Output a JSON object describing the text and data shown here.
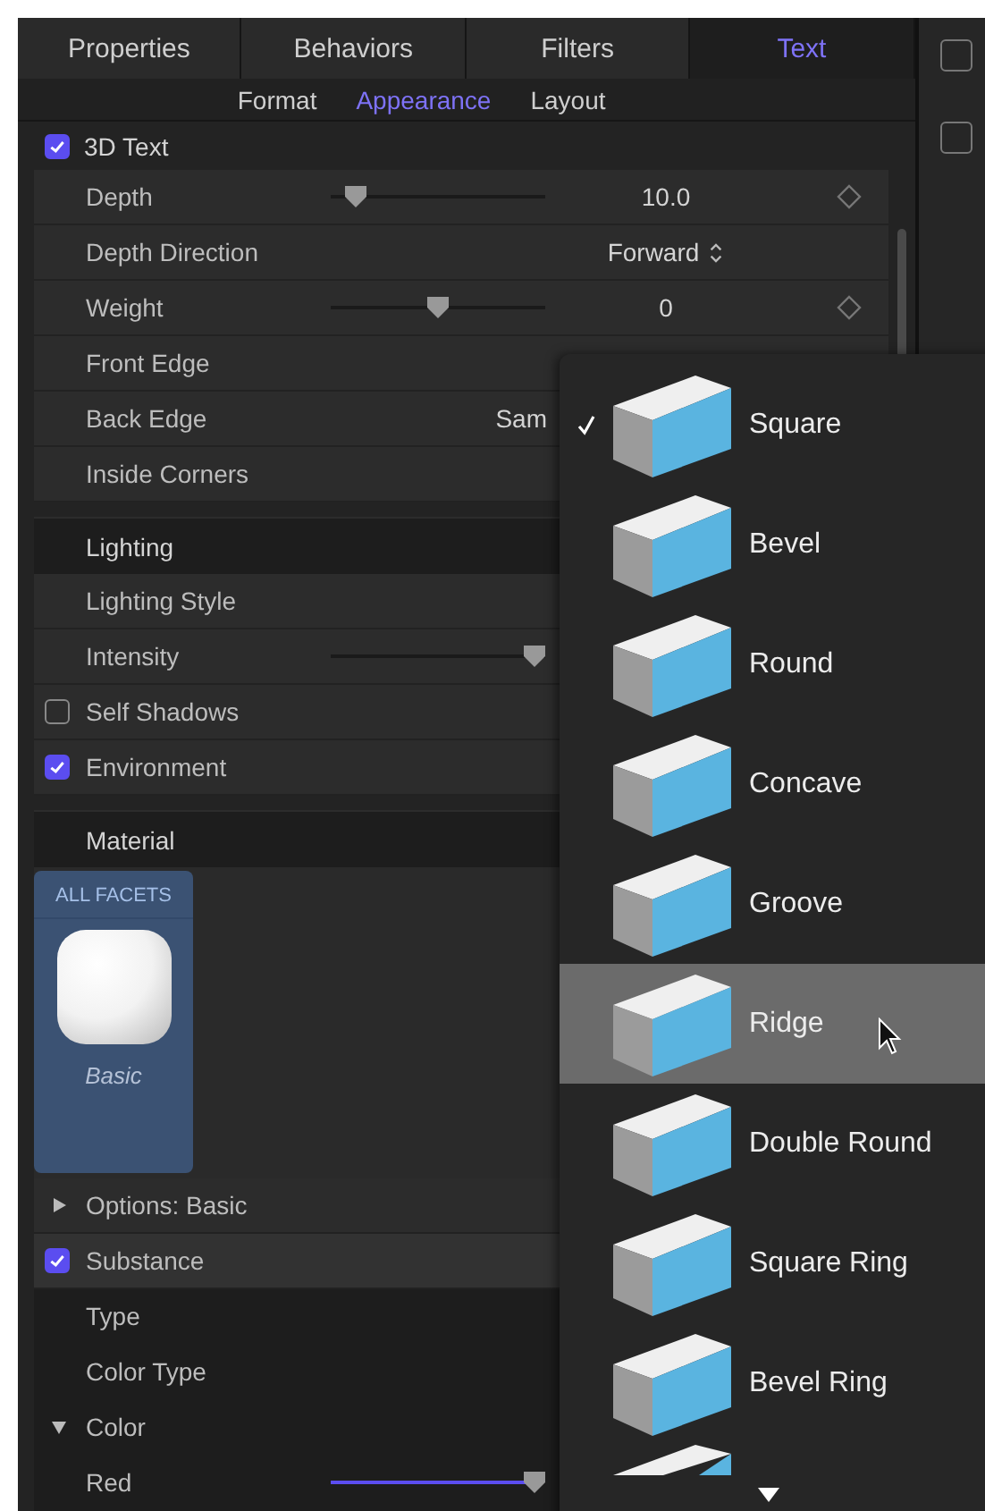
{
  "tabs": [
    {
      "label": "Properties",
      "selected": false
    },
    {
      "label": "Behaviors",
      "selected": false
    },
    {
      "label": "Filters",
      "selected": false
    },
    {
      "label": "Text",
      "selected": true
    }
  ],
  "subtabs": [
    {
      "label": "Format",
      "selected": false
    },
    {
      "label": "Appearance",
      "selected": true
    },
    {
      "label": "Layout",
      "selected": false
    }
  ],
  "sections": [
    {
      "kind": "toggle",
      "label": "3D Text",
      "checked": true,
      "rows": [
        {
          "kind": "slider",
          "label": "Depth",
          "level": 0.12,
          "value": "10.0"
        },
        {
          "kind": "popup",
          "label": "Depth Direction",
          "value": "Forward"
        },
        {
          "kind": "slider",
          "label": "Weight",
          "level": 0.5,
          "value": "0"
        },
        {
          "kind": "label",
          "label": "Front Edge"
        },
        {
          "kind": "truncated",
          "label": "Back Edge",
          "value": "Sam"
        },
        {
          "kind": "label",
          "label": "Inside Corners"
        }
      ]
    },
    {
      "kind": "header",
      "label": "Lighting",
      "rows": [
        {
          "kind": "label",
          "label": "Lighting Style"
        },
        {
          "kind": "slider",
          "label": "Intensity",
          "level": 0.95
        },
        {
          "kind": "checkbox",
          "label": "Self Shadows",
          "checked": false
        },
        {
          "kind": "checkbox",
          "label": "Environment",
          "checked": true
        }
      ]
    },
    {
      "kind": "header",
      "label": "Material",
      "material": {
        "heading": "ALL FACETS",
        "name": "Basic",
        "selected": true
      },
      "rows": [
        {
          "kind": "disclosure",
          "label": "Options: Basic",
          "expanded": false
        },
        {
          "kind": "checkbox",
          "label": "Substance",
          "checked": true,
          "children": [
            {
              "kind": "label",
              "label": "Type"
            },
            {
              "kind": "label",
              "label": "Color Type"
            },
            {
              "kind": "color",
              "label": "Color",
              "expanded": true,
              "children": [
                {
                  "kind": "slider",
                  "label": "Red",
                  "level": 0.95
                }
              ]
            }
          ]
        }
      ]
    }
  ],
  "side_checkboxes": [
    {
      "checked": false
    },
    {
      "checked": false
    }
  ],
  "menu": {
    "items": [
      {
        "label": "Square",
        "selected": true,
        "hovered": false
      },
      {
        "label": "Bevel",
        "selected": false,
        "hovered": false
      },
      {
        "label": "Round",
        "selected": false,
        "hovered": false
      },
      {
        "label": "Concave",
        "selected": false,
        "hovered": false
      },
      {
        "label": "Groove",
        "selected": false,
        "hovered": false
      },
      {
        "label": "Ridge",
        "selected": false,
        "hovered": true
      },
      {
        "label": "Double Round",
        "selected": false,
        "hovered": false
      },
      {
        "label": "Square Ring",
        "selected": false,
        "hovered": false
      },
      {
        "label": "Bevel Ring",
        "selected": false,
        "hovered": false
      }
    ],
    "more_below": true
  }
}
